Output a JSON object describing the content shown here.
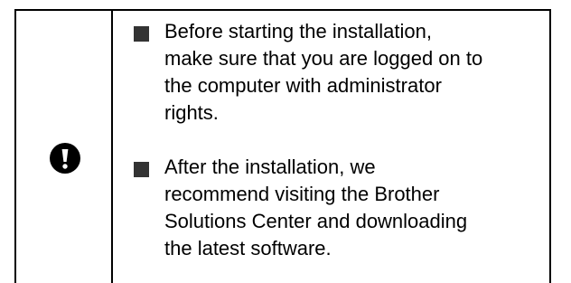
{
  "note": {
    "icon": "important-exclamation-icon",
    "items": [
      {
        "text": "Before starting the installation,\nmake sure that you are logged on to\nthe computer with administrator\nrights."
      },
      {
        "text": "After the installation, we\nrecommend visiting the Brother\nSolutions Center and downloading\nthe latest software."
      }
    ]
  },
  "colors": {
    "text": "#000000",
    "bullet": "#333333",
    "border": "#000000"
  }
}
